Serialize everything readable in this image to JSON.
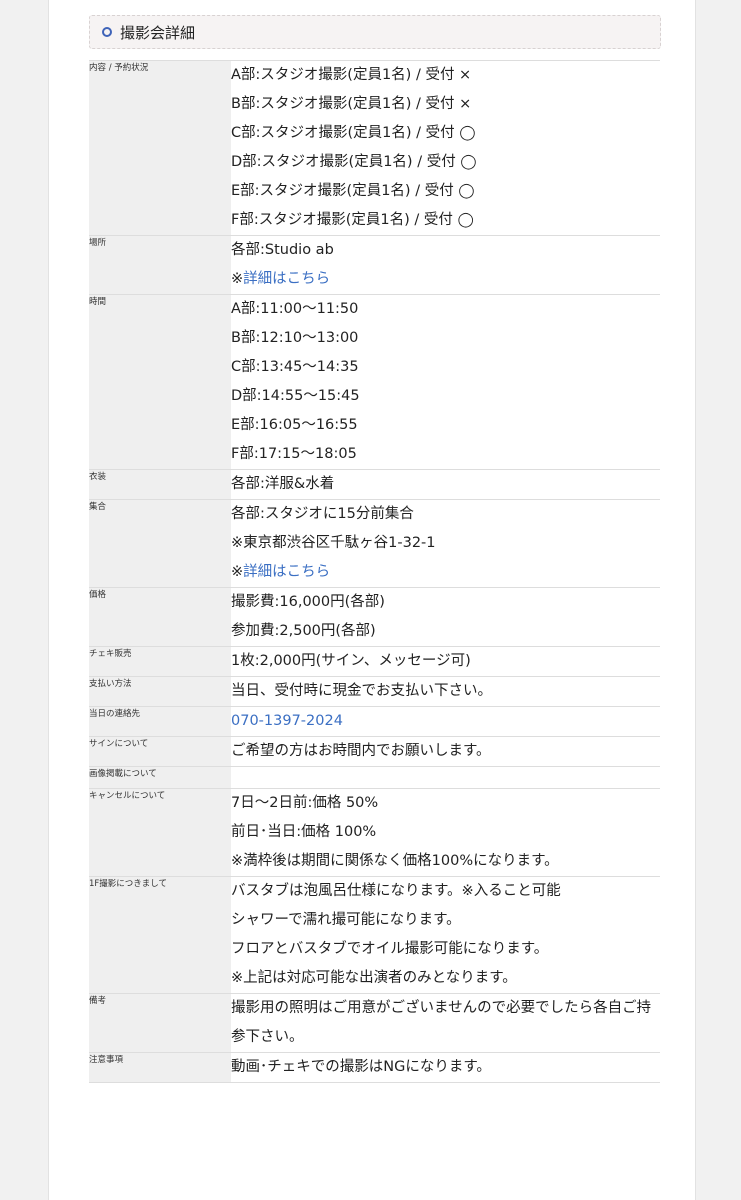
{
  "section_title": "撮影会詳細",
  "rows": [
    {
      "label": "内容 / 予約状況",
      "lines": [
        {
          "text": "A部:スタジオ撮影(定員1名) / 受付 ×"
        },
        {
          "text": "B部:スタジオ撮影(定員1名) / 受付 ×"
        },
        {
          "text": "C部:スタジオ撮影(定員1名) / 受付 ◯"
        },
        {
          "text": "D部:スタジオ撮影(定員1名) / 受付 ◯"
        },
        {
          "text": "E部:スタジオ撮影(定員1名) / 受付 ◯"
        },
        {
          "text": "F部:スタジオ撮影(定員1名) / 受付 ◯"
        }
      ]
    },
    {
      "label": "場所",
      "lines": [
        {
          "text": "各部:Studio ab"
        },
        {
          "prefix": "※",
          "link": "詳細はこちら"
        }
      ]
    },
    {
      "label": "時間",
      "lines": [
        {
          "text": "A部:11:00〜11:50"
        },
        {
          "text": "B部:12:10〜13:00"
        },
        {
          "text": "C部:13:45〜14:35"
        },
        {
          "text": "D部:14:55〜15:45"
        },
        {
          "text": "E部:16:05〜16:55"
        },
        {
          "text": "F部:17:15〜18:05"
        }
      ]
    },
    {
      "label": "衣装",
      "lines": [
        {
          "text": "各部:洋服&水着"
        }
      ]
    },
    {
      "label": "集合",
      "lines": [
        {
          "text": "各部:スタジオに15分前集合"
        },
        {
          "text": "※東京都渋谷区千駄ヶ谷1-32-1"
        },
        {
          "prefix": "※",
          "link": "詳細はこちら"
        }
      ]
    },
    {
      "label": "価格",
      "lines": [
        {
          "text": "撮影費:16,000円(各部)"
        },
        {
          "text": "参加費:2,500円(各部)"
        }
      ]
    },
    {
      "label": "チェキ販売",
      "lines": [
        {
          "text": "1枚:2,000円(サイン、メッセージ可)"
        }
      ]
    },
    {
      "label": "支払い方法",
      "lines": [
        {
          "text": "当日、受付時に現金でお支払い下さい。"
        }
      ]
    },
    {
      "label": "当日の連絡先",
      "lines": [
        {
          "prefix": "",
          "link": "070-1397-2024"
        }
      ]
    },
    {
      "label": "サインについて",
      "lines": [
        {
          "text": "ご希望の方はお時間内でお願いします。"
        }
      ]
    },
    {
      "label": "画像掲載について",
      "lines": []
    },
    {
      "label": "キャンセルについて",
      "lines": [
        {
          "text": "7日〜2日前:価格 50%"
        },
        {
          "text": "前日･当日:価格 100%"
        },
        {
          "text": "※満枠後は期間に関係なく価格100%になります。"
        }
      ]
    },
    {
      "label": "1F撮影につきまして",
      "lines": [
        {
          "text": "バスタブは泡風呂仕様になります。※入ること可能"
        },
        {
          "text": "シャワーで濡れ撮可能になります。"
        },
        {
          "text": "フロアとバスタブでオイル撮影可能になります。"
        },
        {
          "text": "※上記は対応可能な出演者のみとなります。"
        }
      ]
    },
    {
      "label": "備考",
      "lines": [
        {
          "text": "撮影用の照明はご用意がございませんので必要でしたら各自ご持参下さい。",
          "wrap": true
        }
      ]
    },
    {
      "label": "注意事項",
      "lines": [
        {
          "text": "動画･チェキでの撮影はNGになります。"
        }
      ]
    }
  ],
  "colors": {
    "link": "#3b6fc3",
    "label_bg": "#efefef",
    "accent": "#3e63b8"
  }
}
